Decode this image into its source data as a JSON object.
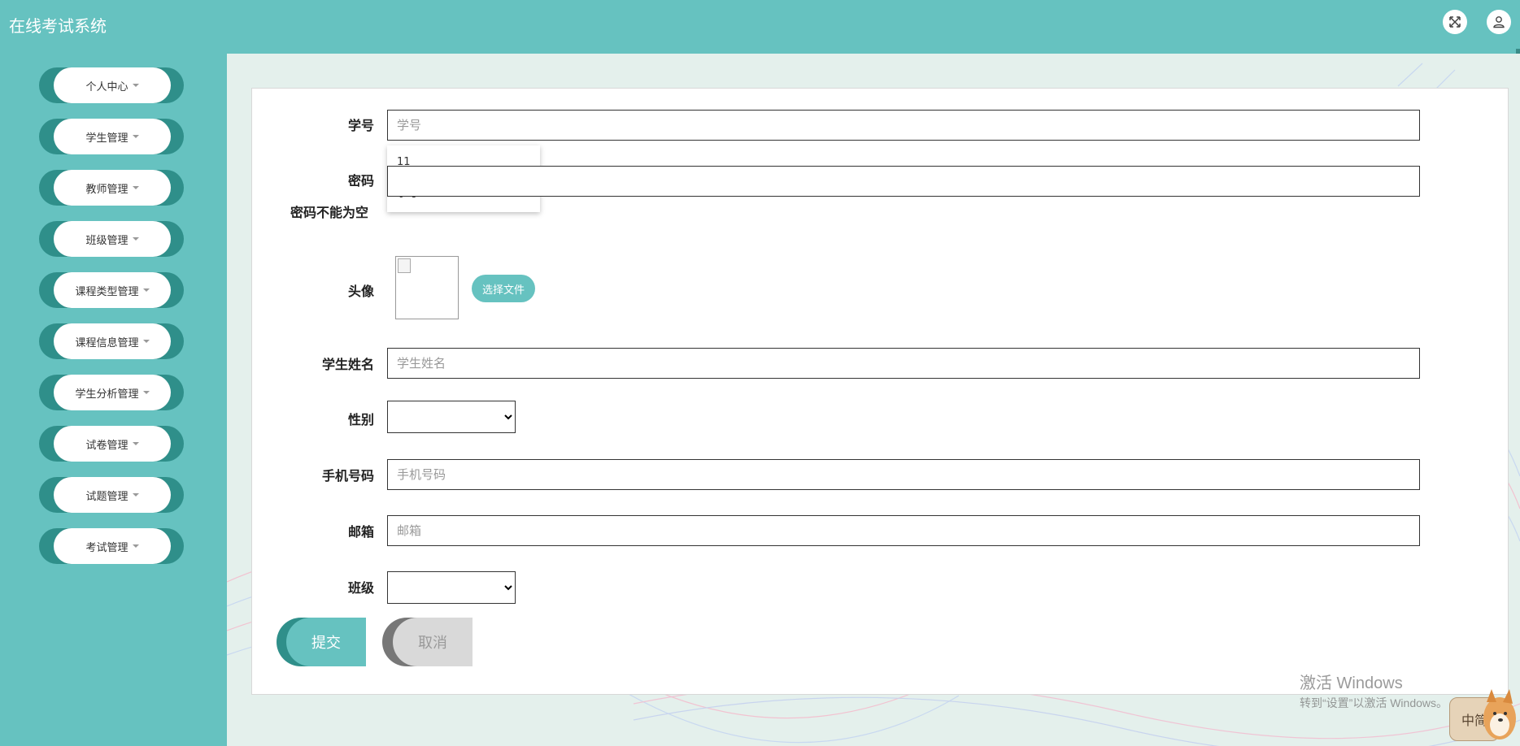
{
  "header": {
    "title": "在线考试系统",
    "fullscreen_icon": "expand-arrows-icon",
    "user_icon": "user-icon"
  },
  "sidebar": {
    "items": [
      {
        "label": "个人中心"
      },
      {
        "label": "学生管理"
      },
      {
        "label": "教师管理"
      },
      {
        "label": "班级管理"
      },
      {
        "label": "课程类型管理"
      },
      {
        "label": "课程信息管理"
      },
      {
        "label": "学生分析管理"
      },
      {
        "label": "试卷管理"
      },
      {
        "label": "试题管理"
      },
      {
        "label": "考试管理"
      }
    ]
  },
  "form": {
    "student_id": {
      "label": "学号",
      "placeholder": "学号",
      "value": ""
    },
    "autocomplete": [
      "11",
      "学号1"
    ],
    "password": {
      "label": "密码",
      "error": "密码不能为空"
    },
    "avatar": {
      "label": "头像",
      "button": "选择文件"
    },
    "student_name": {
      "label": "学生姓名",
      "placeholder": "学生姓名"
    },
    "gender": {
      "label": "性别",
      "selected": ""
    },
    "phone": {
      "label": "手机号码",
      "placeholder": "手机号码"
    },
    "email": {
      "label": "邮箱",
      "placeholder": "邮箱"
    },
    "class": {
      "label": "班级",
      "selected": ""
    },
    "submit": "提交",
    "cancel": "取消"
  },
  "watermark": {
    "line1": "激活 Windows",
    "line2": "转到“设置”以激活 Windows。"
  },
  "ime": {
    "label": "中简"
  },
  "colors": {
    "primary": "#66c2c0",
    "primary_dark": "#2f8f8a",
    "background": "#e4f0ec"
  }
}
